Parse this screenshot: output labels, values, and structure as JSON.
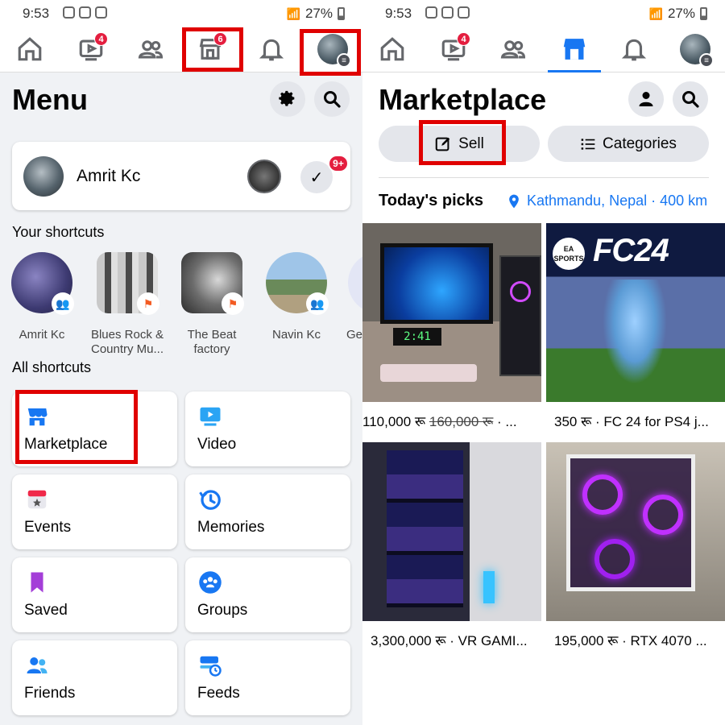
{
  "left": {
    "status": {
      "time": "9:53",
      "battery": "27%"
    },
    "tabs": [
      {
        "name": "home",
        "badge": ""
      },
      {
        "name": "video",
        "badge": "4"
      },
      {
        "name": "friends",
        "badge": ""
      },
      {
        "name": "marketplace",
        "badge": "6"
      },
      {
        "name": "notifications",
        "badge": ""
      },
      {
        "name": "menu",
        "badge": ""
      }
    ],
    "title": "Menu",
    "profile": {
      "name": "Amrit Kc",
      "notif_badge": "9+"
    },
    "your_shortcuts_label": "Your shortcuts",
    "shortcuts": [
      {
        "label": "Amrit Kc"
      },
      {
        "label": "Blues Rock & Country Mu..."
      },
      {
        "label": "The Beat factory"
      },
      {
        "label": "Navin Kc"
      },
      {
        "label": "Ge"
      }
    ],
    "all_shortcuts_label": "All shortcuts",
    "tiles": [
      {
        "label": "Marketplace"
      },
      {
        "label": "Video"
      },
      {
        "label": "Events"
      },
      {
        "label": "Memories"
      },
      {
        "label": "Saved"
      },
      {
        "label": "Groups"
      },
      {
        "label": "Friends"
      },
      {
        "label": "Feeds"
      }
    ]
  },
  "right": {
    "status": {
      "time": "9:53",
      "battery": "27%"
    },
    "tabs": [
      {
        "name": "home",
        "badge": ""
      },
      {
        "name": "video",
        "badge": "4"
      },
      {
        "name": "friends",
        "badge": ""
      },
      {
        "name": "marketplace",
        "badge": ""
      },
      {
        "name": "notifications",
        "badge": ""
      },
      {
        "name": "menu",
        "badge": ""
      }
    ],
    "title": "Marketplace",
    "sell_label": "Sell",
    "categories_label": "Categories",
    "picks_label": "Today's picks",
    "location": "Kathmandu, Nepal · 400 km",
    "products": [
      {
        "price": "110,000 रू",
        "old_price": "160,000 रू",
        "title": " · ..."
      },
      {
        "price": "350 रू",
        "old_price": "",
        "title": " · FC 24 for PS4 j..."
      },
      {
        "price": "3,300,000 रू",
        "old_price": "",
        "title": " · VR GAMI..."
      },
      {
        "price": "195,000 रू",
        "old_price": "",
        "title": " · RTX 4070 ..."
      }
    ],
    "product_image_text": {
      "fc24_brand": "EA SPORTS",
      "fc24_title": "FC24",
      "monitor_clock": "2:41"
    }
  },
  "colors": {
    "accent": "#1877f2",
    "badge": "#e41e3f",
    "highlight": "#e00000"
  }
}
